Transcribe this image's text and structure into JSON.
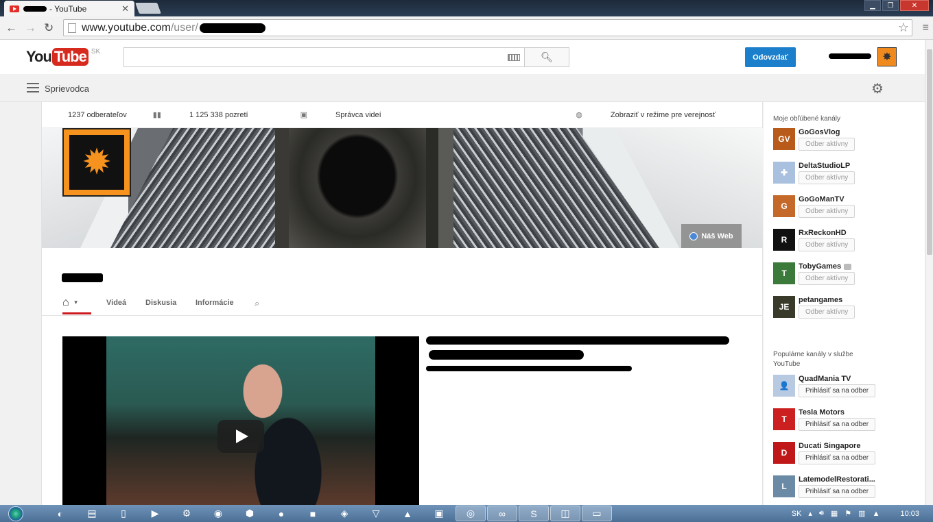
{
  "browser": {
    "tab_title": " - YouTube",
    "url_domain": "www.youtube.com",
    "url_path": "/user/"
  },
  "header": {
    "logo_you": "You",
    "logo_tube": "Tube",
    "logo_locale": "SK",
    "subscribe_label": "Odovzdať"
  },
  "guide": {
    "label": "Sprievodca"
  },
  "stats": {
    "subscribers": "1237 odberateľov",
    "views": "1 125 338 pozretí",
    "video_manager": "Správca videí",
    "public_view": "Zobraziť v režime pre verejnosť"
  },
  "banner": {
    "web_link": "Náš Web"
  },
  "channel_tabs": {
    "videos": "Videá",
    "discussion": "Diskusia",
    "info": "Informácie"
  },
  "sidebar": {
    "favorites_title": "Moje obľúbené kanály",
    "favorites": [
      {
        "name": "GoGosVlog",
        "button": "Odber aktívny",
        "color": "#b75a1a",
        "icon": "GV"
      },
      {
        "name": "DeltaStudioLP",
        "button": "Odber aktívny",
        "color": "#a9c0de",
        "icon": "✚"
      },
      {
        "name": "GoGoManTV",
        "button": "Odber aktívny",
        "color": "#c4692a",
        "icon": "G"
      },
      {
        "name": "RxReckonHD",
        "button": "Odber aktívny",
        "color": "#111111",
        "icon": "R"
      },
      {
        "name": "TobyGames",
        "button": "Odber aktívny",
        "color": "#3c7a3c",
        "icon": "T"
      },
      {
        "name": "petangames",
        "button": "Odber aktívny",
        "color": "#3a3a2a",
        "icon": "JE"
      }
    ],
    "popular_title": "Populárne kanály v službe YouTube",
    "popular": [
      {
        "name": "QuadMania TV",
        "button": "Prihlásiť sa na odber",
        "color": "#b8c9e2",
        "icon": "👤"
      },
      {
        "name": "Tesla Motors",
        "button": "Prihlásiť sa na odber",
        "color": "#cc1f1f",
        "icon": "T"
      },
      {
        "name": "Ducati Singapore",
        "button": "Prihlásiť sa na odber",
        "color": "#c01818",
        "icon": "D"
      },
      {
        "name": "LatemodelRestorati...",
        "button": "Prihlásiť sa na odber",
        "color": "#6a8aa5",
        "icon": "L"
      }
    ]
  },
  "taskbar": {
    "lang": "SK",
    "clock": "10:03"
  }
}
